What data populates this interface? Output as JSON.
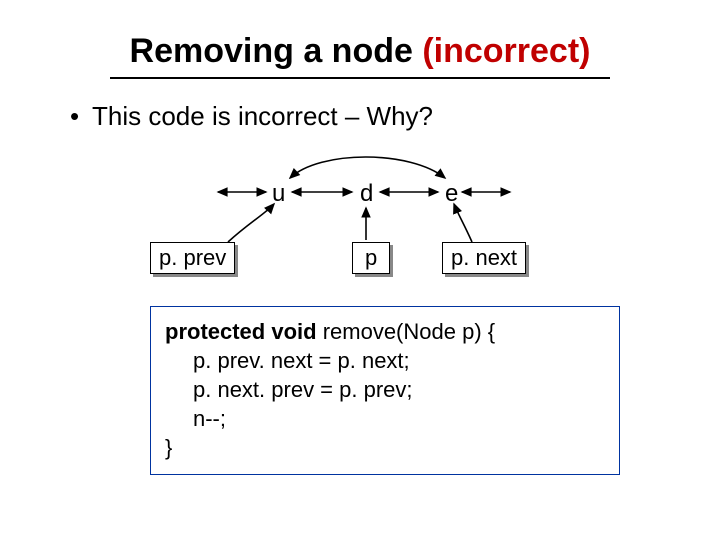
{
  "title": {
    "part1": "Removing a node",
    "part2": " (incorrect)"
  },
  "bullet": {
    "dot": "•",
    "text": "This code is incorrect – Why?"
  },
  "diagram": {
    "u": "u",
    "d": "d",
    "e": "e",
    "pprev": "p. prev",
    "p": "p",
    "pnext": "p. next"
  },
  "code": {
    "kw_protected_void": "protected void",
    "sig_rest": " remove(Node p) {",
    "l1": "p. prev. next = p. next;",
    "l2": "p. next. prev = p. prev;",
    "l3": "n--;",
    "close": "}"
  }
}
